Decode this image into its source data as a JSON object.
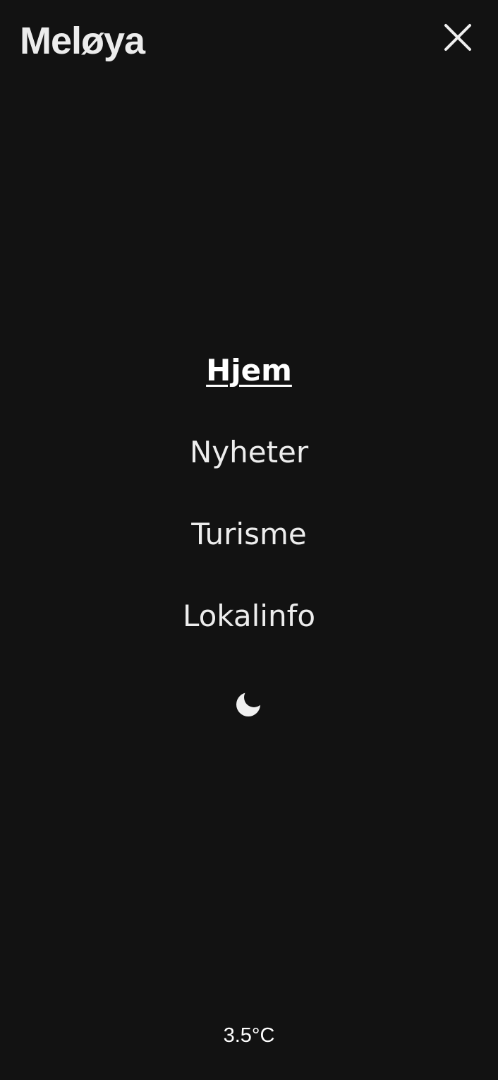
{
  "header": {
    "logo_text": "Meløya",
    "close_icon": "close-icon"
  },
  "menu": {
    "items": [
      {
        "label": "Hjem",
        "active": true
      },
      {
        "label": "Nyheter",
        "active": false
      },
      {
        "label": "Turisme",
        "active": false
      },
      {
        "label": "Lokalinfo",
        "active": false
      }
    ]
  },
  "theme_toggle": {
    "icon": "moon-icon"
  },
  "weather": {
    "temperature": "3.5°C"
  },
  "colors": {
    "background": "#121212",
    "text": "#ededed"
  }
}
